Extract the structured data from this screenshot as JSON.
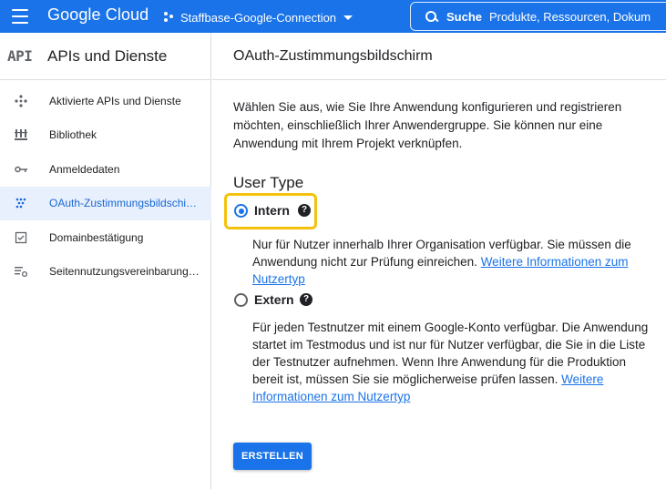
{
  "topbar": {
    "brand": "Google Cloud",
    "project": "Staffbase-Google-Connection",
    "search_label": "Suche",
    "search_placeholder": "Produkte, Ressourcen, Dokum"
  },
  "sidebar": {
    "logo": "API",
    "title": "APIs und Dienste",
    "items": [
      {
        "label": "Aktivierte APIs und Dienste",
        "icon": "api-diamond-icon"
      },
      {
        "label": "Bibliothek",
        "icon": "library-icon"
      },
      {
        "label": "Anmeldedaten",
        "icon": "key-icon"
      },
      {
        "label": "OAuth-Zustimmungsbildschi…",
        "icon": "consent-dots-icon",
        "active": true
      },
      {
        "label": "Domainbestätigung",
        "icon": "checkbox-icon"
      },
      {
        "label": "Seitennutzungsvereinbarung…",
        "icon": "settings-list-icon"
      }
    ]
  },
  "main": {
    "title": "OAuth-Zustimmungsbildschirm",
    "intro": "Wählen Sie aus, wie Sie Ihre Anwendung konfigurieren und registrieren möchten, einschließlich Ihrer Anwendergruppe. Sie können nur eine Anwendung mit Ihrem Projekt verknüpfen.",
    "user_type_heading": "User Type",
    "options": [
      {
        "label": "Intern",
        "checked": true,
        "desc": "Nur für Nutzer innerhalb Ihrer Organisation verfügbar. Sie müssen die Anwendung nicht zur Prüfung einreichen.",
        "link": "Weitere Informationen zum Nutzertyp"
      },
      {
        "label": "Extern",
        "checked": false,
        "desc": "Für jeden Testnutzer mit einem Google-Konto verfügbar. Die Anwendung startet im Testmodus und ist nur für Nutzer verfügbar, die Sie in die Liste der Testnutzer aufnehmen. Wenn Ihre Anwendung für die Produktion bereit ist, müssen Sie sie möglicherweise prüfen lassen.",
        "link": "Weitere Informationen zum Nutzertyp"
      }
    ],
    "help_glyph": "?",
    "create_label": "ERSTELLEN"
  },
  "colors": {
    "accent": "#1a73e8",
    "highlight": "#f4c20d",
    "active_bg": "#e8f0fe"
  }
}
